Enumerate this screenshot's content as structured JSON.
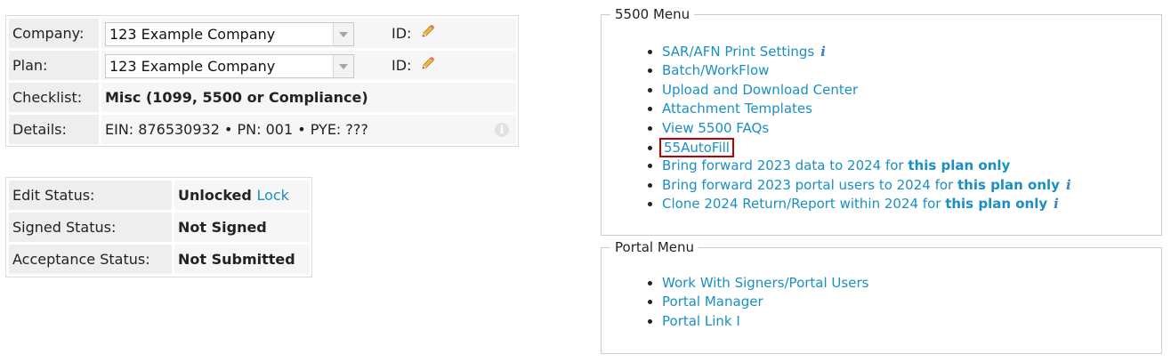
{
  "company_panel": {
    "rows": [
      {
        "label": "Company:",
        "select_value": "123 Example Company",
        "id_label": "ID:"
      },
      {
        "label": "Plan:",
        "select_value": "123 Example Company",
        "id_label": "ID:"
      },
      {
        "label": "Checklist:",
        "value": "Misc (1099, 5500 or Compliance)"
      },
      {
        "label": "Details:",
        "value": "EIN: 876530932 • PN: 001 • PYE: ???"
      }
    ]
  },
  "status_panel": {
    "rows": [
      {
        "label": "Edit Status:",
        "value": "Unlocked",
        "link": "Lock"
      },
      {
        "label": "Signed Status:",
        "value": "Not Signed"
      },
      {
        "label": "Acceptance Status:",
        "value": "Not Submitted"
      }
    ]
  },
  "menu_5500": {
    "legend": "5500 Menu",
    "items": [
      {
        "text": "SAR/AFN Print Settings",
        "info": true
      },
      {
        "text": "Batch/WorkFlow"
      },
      {
        "text": "Upload and Download Center"
      },
      {
        "text": "Attachment Templates"
      },
      {
        "text": "View 5500 FAQs"
      },
      {
        "text": "55AutoFill",
        "highlighted": true
      },
      {
        "text": "Bring forward 2023 data to 2024 for ",
        "bold": "this plan only"
      },
      {
        "text": "Bring forward 2023 portal users to 2024 for ",
        "bold": "this plan only",
        "info": true
      },
      {
        "text": "Clone 2024 Return/Report within 2024 for ",
        "bold": "this plan only",
        "info": true
      }
    ]
  },
  "menu_portal": {
    "legend": "Portal Menu",
    "items": [
      {
        "text": "Work With Signers/Portal Users"
      },
      {
        "text": "Portal Manager"
      },
      {
        "text": "Portal Link I"
      }
    ]
  },
  "colors": {
    "link": "#1a8fc2",
    "highlight_border": "#c00000",
    "label_bg": "#eeeeee",
    "value_bg": "#f6f6f6"
  },
  "icons": {
    "info": "i",
    "pencil": "pencil-icon",
    "dropdown": "chevron-down-icon"
  }
}
